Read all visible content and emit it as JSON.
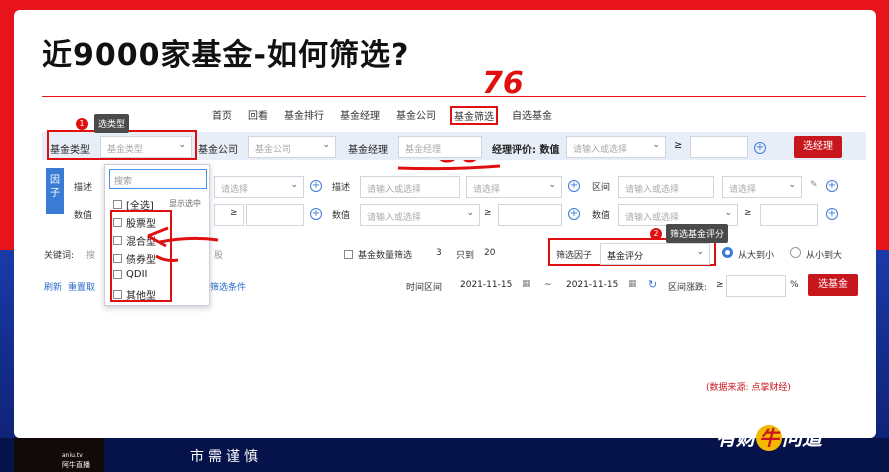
{
  "headline": "近9000家基金-如何筛选?",
  "annotations": {
    "num76": "76",
    "num80": "80",
    "num5": "5"
  },
  "nav": [
    "首页",
    "回看",
    "基金排行",
    "基金经理",
    "基金公司",
    "基金筛选",
    "自选基金"
  ],
  "filter": {
    "type_label": "基金类型",
    "type_placeholder": "基金类型",
    "company_label": "基金公司",
    "company_placeholder": "基金公司",
    "manager_label": "基金经理",
    "manager_placeholder": "基金经理",
    "rating_label": "经理评价: 数值",
    "rating_placeholder": "请输入或选择",
    "ge": "≥",
    "select_manager_btn": "选经理"
  },
  "tips": {
    "select_type": "选类型",
    "screen_rating": "筛选基金评分"
  },
  "badges": {
    "one": "1",
    "two": "2"
  },
  "factor_label": "因子",
  "rows": {
    "describe": "描述",
    "value": "数值",
    "placeholder": "请输入或选择",
    "select": "请选择",
    "range": "区间",
    "ge": "≥"
  },
  "dropdown": {
    "search": "搜索",
    "all": "[全选]",
    "show_selected": "显示选中",
    "options": [
      "股票型",
      "混合型",
      "债券型",
      "QDII",
      "其他型"
    ]
  },
  "keywords": {
    "label": "关键词:",
    "placeholder": "搜",
    "stock": "股"
  },
  "count_filter": {
    "label": "基金数量筛选",
    "value": "3",
    "only": "只到",
    "to": "20"
  },
  "factor_filter": {
    "label": "筛选因子",
    "value": "基金评分"
  },
  "sort": {
    "desc": "从大到小",
    "asc": "从小到大"
  },
  "links": {
    "refresh": "刷新",
    "reset": "重置取",
    "conditions": "筛选条件"
  },
  "time": {
    "label": "时间区间",
    "from": "2021-11-15",
    "sep": "~",
    "to": "2021-11-15",
    "change": "区间涨跌:",
    "ge": "≥",
    "pct": "%"
  },
  "select_fund_btn": "选基金",
  "source": "(数据来源: 点掌财经)",
  "ticker": "市需谨慎",
  "logo_left": "阿牛直播",
  "logo_left_url": "aniu.tv",
  "logo_right": {
    "a": "有财",
    "b": "牛",
    "c": "问道"
  }
}
